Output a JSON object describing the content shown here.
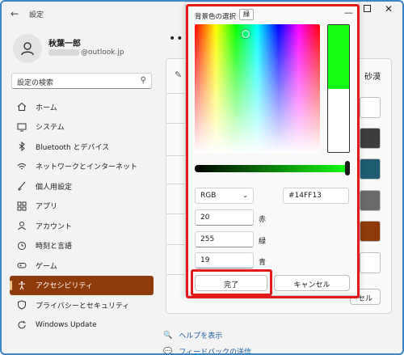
{
  "window": {
    "title": "設定",
    "back_icon": "arrow-left-icon"
  },
  "user": {
    "name": "秋葉一郎",
    "email_suffix": "@outlook.jp"
  },
  "search": {
    "placeholder": "設定の検索"
  },
  "nav": {
    "items": [
      {
        "label": "ホーム",
        "icon": "home-icon"
      },
      {
        "label": "システム",
        "icon": "monitor-icon"
      },
      {
        "label": "Bluetooth とデバイス",
        "icon": "bluetooth-icon"
      },
      {
        "label": "ネットワークとインターネット",
        "icon": "wifi-icon"
      },
      {
        "label": "個人用設定",
        "icon": "brush-icon"
      },
      {
        "label": "アプリ",
        "icon": "apps-icon"
      },
      {
        "label": "アカウント",
        "icon": "person-icon"
      },
      {
        "label": "時刻と言語",
        "icon": "clock-icon"
      },
      {
        "label": "ゲーム",
        "icon": "gamepad-icon"
      },
      {
        "label": "アクセシビリティ",
        "icon": "accessibility-icon"
      },
      {
        "label": "プライバシーとセキュリティ",
        "icon": "shield-icon"
      },
      {
        "label": "Windows Update",
        "icon": "update-icon"
      }
    ],
    "active_index": 9,
    "active_color": "#8f3a0a"
  },
  "main": {
    "column_label": "砂漠",
    "cancel_label": "セル",
    "help_link": "ヘルプを表示",
    "feedback_link": "フィードバックの送信",
    "swatches": [
      "#ffffff",
      "#3d3d3d",
      "#1f5c73",
      "#6a6a6a",
      "#8f3a0a",
      "#ffffff"
    ]
  },
  "color_dialog": {
    "title": "背景色の選択",
    "tag": "緑",
    "mode_select": "RGB",
    "hex_value": "#14FF13",
    "red_value": "20",
    "red_label": "赤",
    "green_value": "255",
    "green_label": "緑",
    "blue_value": "19",
    "blue_label": "青",
    "ok_label": "完了",
    "cancel_label": "キャンセル",
    "selected_color": "#14ff13"
  }
}
